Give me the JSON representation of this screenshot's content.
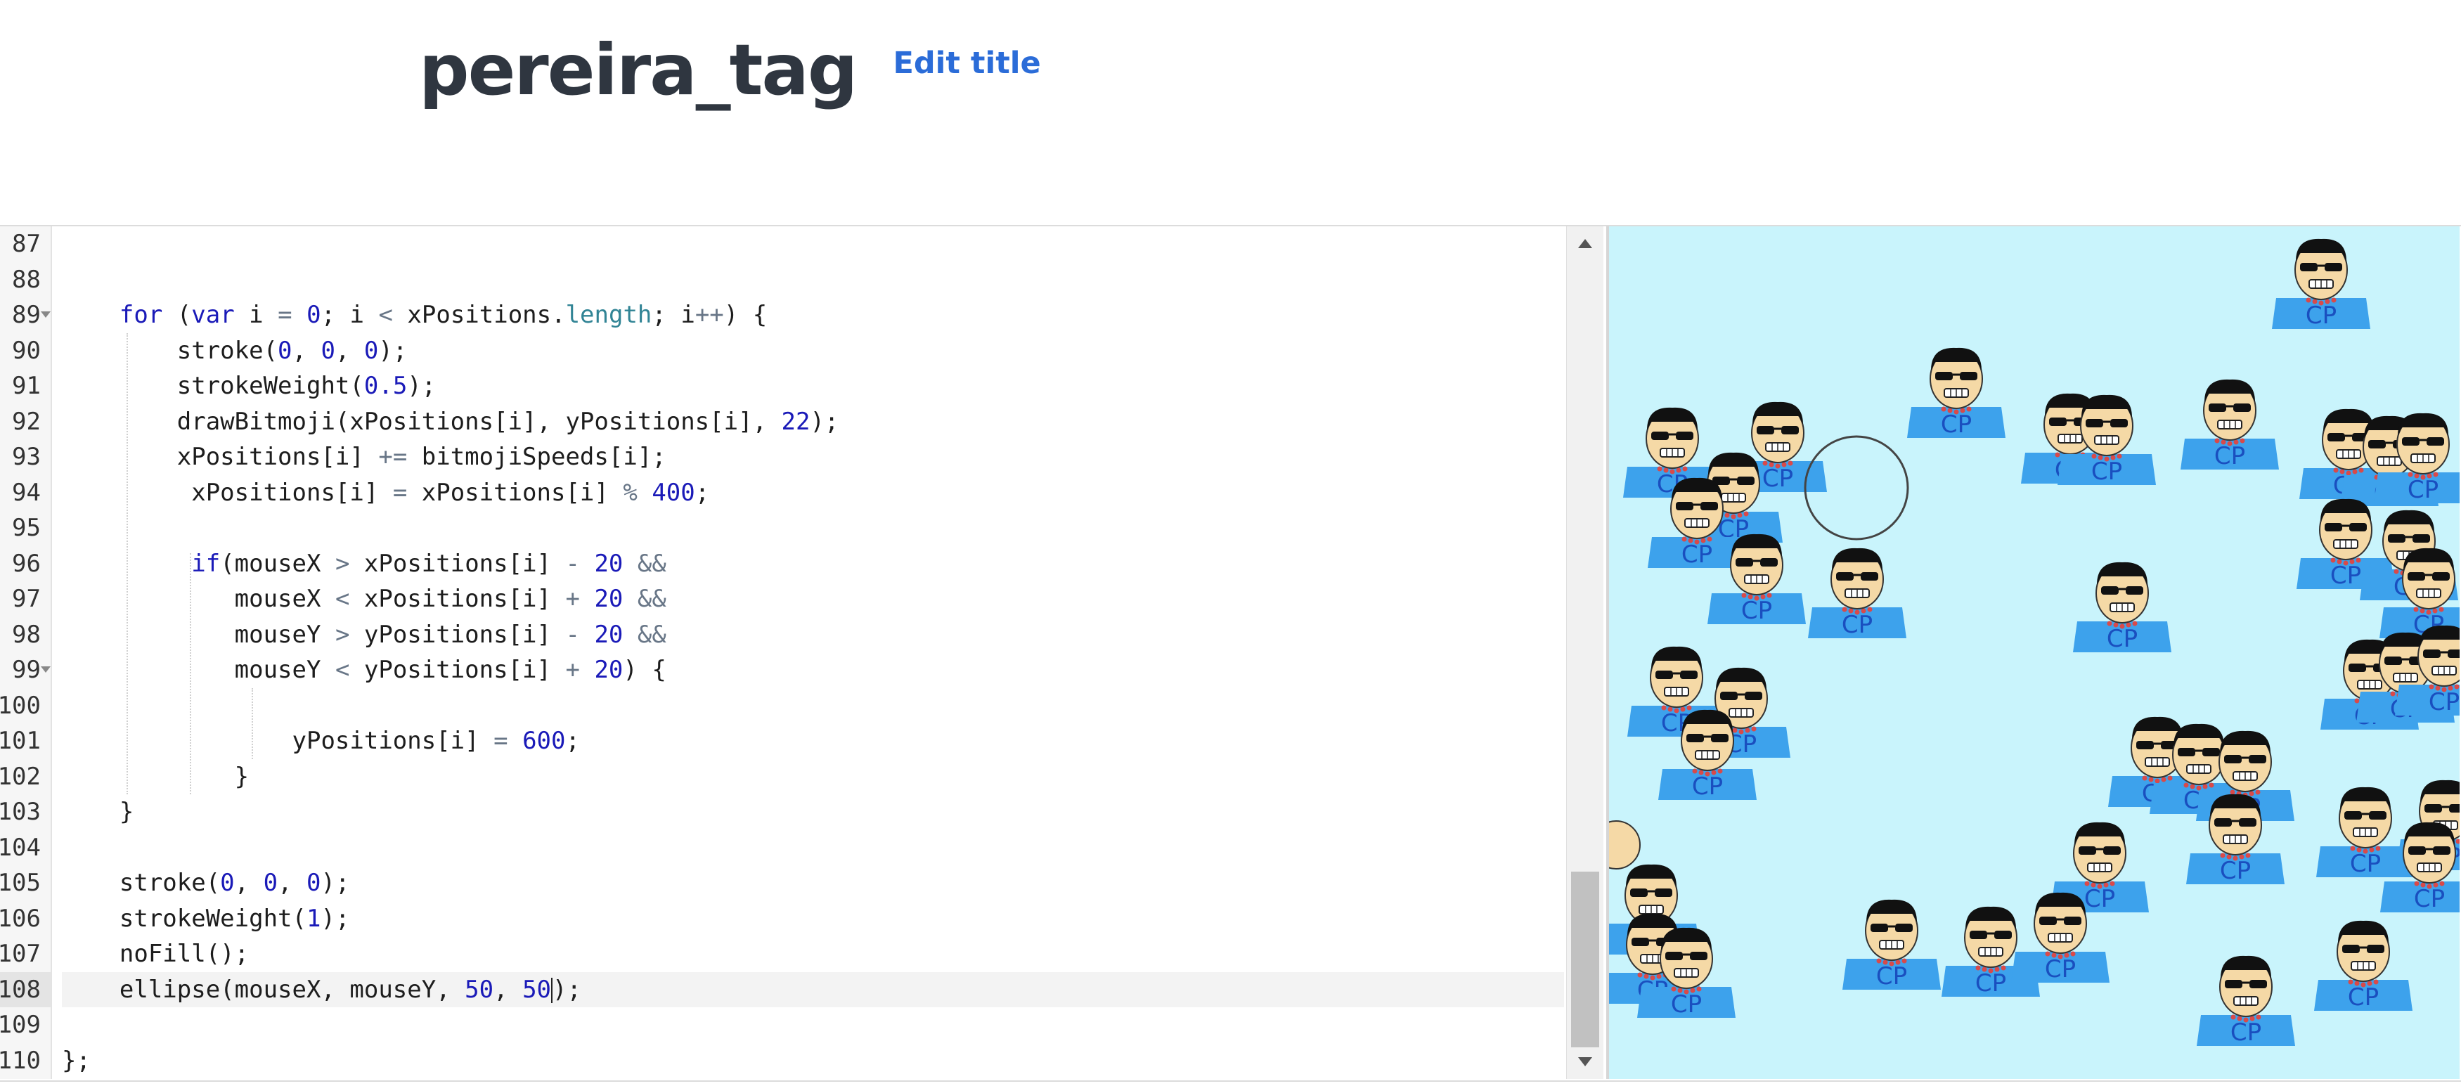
{
  "project": {
    "title": "pereira_tag",
    "edit_title_label": "Edit title"
  },
  "editor": {
    "first_line_number": 87,
    "active_line_number": 108,
    "fold_markers": [
      89,
      99
    ],
    "lines": [
      [],
      [],
      [
        [
          "t",
          "    "
        ],
        [
          "kw",
          "for"
        ],
        [
          "t",
          " ("
        ],
        [
          "kw",
          "var"
        ],
        [
          "t",
          " i "
        ],
        [
          "op",
          "="
        ],
        [
          "t",
          " "
        ],
        [
          "num",
          "0"
        ],
        [
          "t",
          "; i "
        ],
        [
          "op",
          "<"
        ],
        [
          "t",
          " xPositions."
        ],
        [
          "prop",
          "length"
        ],
        [
          "t",
          "; i"
        ],
        [
          "op",
          "++"
        ],
        [
          "t",
          ") {"
        ]
      ],
      [
        [
          "t",
          "        stroke("
        ],
        [
          "num",
          "0"
        ],
        [
          "t",
          ", "
        ],
        [
          "num",
          "0"
        ],
        [
          "t",
          ", "
        ],
        [
          "num",
          "0"
        ],
        [
          "t",
          ");"
        ]
      ],
      [
        [
          "t",
          "        strokeWeight("
        ],
        [
          "num",
          "0.5"
        ],
        [
          "t",
          ");"
        ]
      ],
      [
        [
          "t",
          "        drawBitmoji(xPositions[i], yPositions[i], "
        ],
        [
          "num",
          "22"
        ],
        [
          "t",
          ");"
        ]
      ],
      [
        [
          "t",
          "        xPositions[i] "
        ],
        [
          "op",
          "+="
        ],
        [
          "t",
          " bitmojiSpeeds[i];"
        ]
      ],
      [
        [
          "t",
          "         xPositions[i] "
        ],
        [
          "op",
          "="
        ],
        [
          "t",
          " xPositions[i] "
        ],
        [
          "op",
          "%"
        ],
        [
          "t",
          " "
        ],
        [
          "num",
          "400"
        ],
        [
          "t",
          ";"
        ]
      ],
      [],
      [
        [
          "t",
          "         "
        ],
        [
          "kw",
          "if"
        ],
        [
          "t",
          "(mouseX "
        ],
        [
          "op",
          ">"
        ],
        [
          "t",
          " xPositions[i] "
        ],
        [
          "op",
          "-"
        ],
        [
          "t",
          " "
        ],
        [
          "num",
          "20"
        ],
        [
          "t",
          " "
        ],
        [
          "op",
          "&&"
        ]
      ],
      [
        [
          "t",
          "            mouseX "
        ],
        [
          "op",
          "<"
        ],
        [
          "t",
          " xPositions[i] "
        ],
        [
          "op",
          "+"
        ],
        [
          "t",
          " "
        ],
        [
          "num",
          "20"
        ],
        [
          "t",
          " "
        ],
        [
          "op",
          "&&"
        ]
      ],
      [
        [
          "t",
          "            mouseY "
        ],
        [
          "op",
          ">"
        ],
        [
          "t",
          " yPositions[i] "
        ],
        [
          "op",
          "-"
        ],
        [
          "t",
          " "
        ],
        [
          "num",
          "20"
        ],
        [
          "t",
          " "
        ],
        [
          "op",
          "&&"
        ]
      ],
      [
        [
          "t",
          "            mouseY "
        ],
        [
          "op",
          "<"
        ],
        [
          "t",
          " yPositions[i] "
        ],
        [
          "op",
          "+"
        ],
        [
          "t",
          " "
        ],
        [
          "num",
          "20"
        ],
        [
          "t",
          ") {"
        ]
      ],
      [],
      [
        [
          "t",
          "                yPositions[i] "
        ],
        [
          "op",
          "="
        ],
        [
          "t",
          " "
        ],
        [
          "num",
          "600"
        ],
        [
          "t",
          ";"
        ]
      ],
      [
        [
          "t",
          "            }"
        ]
      ],
      [
        [
          "t",
          "    }"
        ]
      ],
      [],
      [
        [
          "t",
          "    stroke("
        ],
        [
          "num",
          "0"
        ],
        [
          "t",
          ", "
        ],
        [
          "num",
          "0"
        ],
        [
          "t",
          ", "
        ],
        [
          "num",
          "0"
        ],
        [
          "t",
          ");"
        ]
      ],
      [
        [
          "t",
          "    strokeWeight("
        ],
        [
          "num",
          "1"
        ],
        [
          "t",
          ");"
        ]
      ],
      [
        [
          "t",
          "    noFill();"
        ]
      ],
      [
        [
          "t",
          "    ellipse(mouseX, mouseY, "
        ],
        [
          "num",
          "50"
        ],
        [
          "t",
          ", "
        ],
        [
          "num",
          "50"
        ],
        [
          "cursor",
          ""
        ],
        [
          "t",
          ");"
        ]
      ],
      [],
      [
        [
          "t",
          "};"
        ]
      ]
    ]
  },
  "preview": {
    "background": "#c9f4fc",
    "shirt_label": "CP",
    "colors": {
      "shirt": "#3da2ec",
      "skin": "#f5d9a6",
      "hair": "#111111",
      "glasses": "#111111",
      "collar": "#d84a4a",
      "text": "#1a4fbf"
    }
  }
}
